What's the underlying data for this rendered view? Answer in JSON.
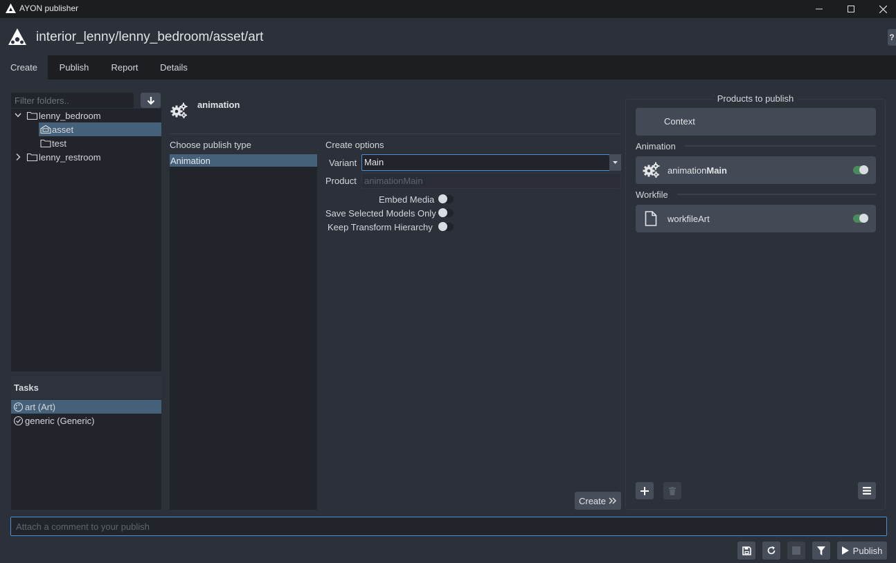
{
  "window": {
    "title": "AYON publisher",
    "controls": {
      "minimize": "minimize-icon",
      "maximize": "maximize-icon",
      "close": "close-icon"
    }
  },
  "header": {
    "context_path": "interior_lenny/lenny_bedroom/asset/art",
    "help_label": "?"
  },
  "tabs": [
    {
      "label": "Create",
      "active": true
    },
    {
      "label": "Publish",
      "active": false
    },
    {
      "label": "Report",
      "active": false
    },
    {
      "label": "Details",
      "active": false
    }
  ],
  "folders": {
    "filter_placeholder": "Filter folders..",
    "items": [
      {
        "label": "lenny_bedroom",
        "expanded": true,
        "level": 0
      },
      {
        "label": "asset",
        "selected": true,
        "level": 1
      },
      {
        "label": "test",
        "level": 1
      },
      {
        "label": "lenny_restroom",
        "expanded": false,
        "level": 0
      }
    ]
  },
  "tasks": {
    "heading": "Tasks",
    "items": [
      {
        "label": "art (Art)",
        "selected": true
      },
      {
        "label": "generic (Generic)",
        "selected": false
      }
    ]
  },
  "creator": {
    "name": "animation",
    "publish_type_label": "Choose publish type",
    "publish_types": [
      "Animation"
    ],
    "create_options_label": "Create options",
    "variant_label": "Variant",
    "variant_value": "Main",
    "product_label": "Product",
    "product_value": "animationMain",
    "options": [
      {
        "label": "Embed Media",
        "enabled": false
      },
      {
        "label": "Save Selected Models Only",
        "enabled": false
      },
      {
        "label": "Keep Transform Hierarchy",
        "enabled": false
      }
    ],
    "create_button": "Create"
  },
  "products": {
    "title": "Products to publish",
    "context_label": "Context",
    "groups": [
      {
        "label": "Animation",
        "items": [
          {
            "prefix": "animation",
            "bold": "Main",
            "enabled": true
          }
        ]
      },
      {
        "label": "Workfile",
        "items": [
          {
            "prefix": "workfileArt",
            "bold": "",
            "enabled": true
          }
        ]
      }
    ]
  },
  "footer": {
    "comment_placeholder": "Attach a comment to your publish",
    "publish_button": "Publish"
  },
  "colors": {
    "accent": "#4d8fd4",
    "selection": "#45617a",
    "toggle_on": "#4a8b5e"
  }
}
